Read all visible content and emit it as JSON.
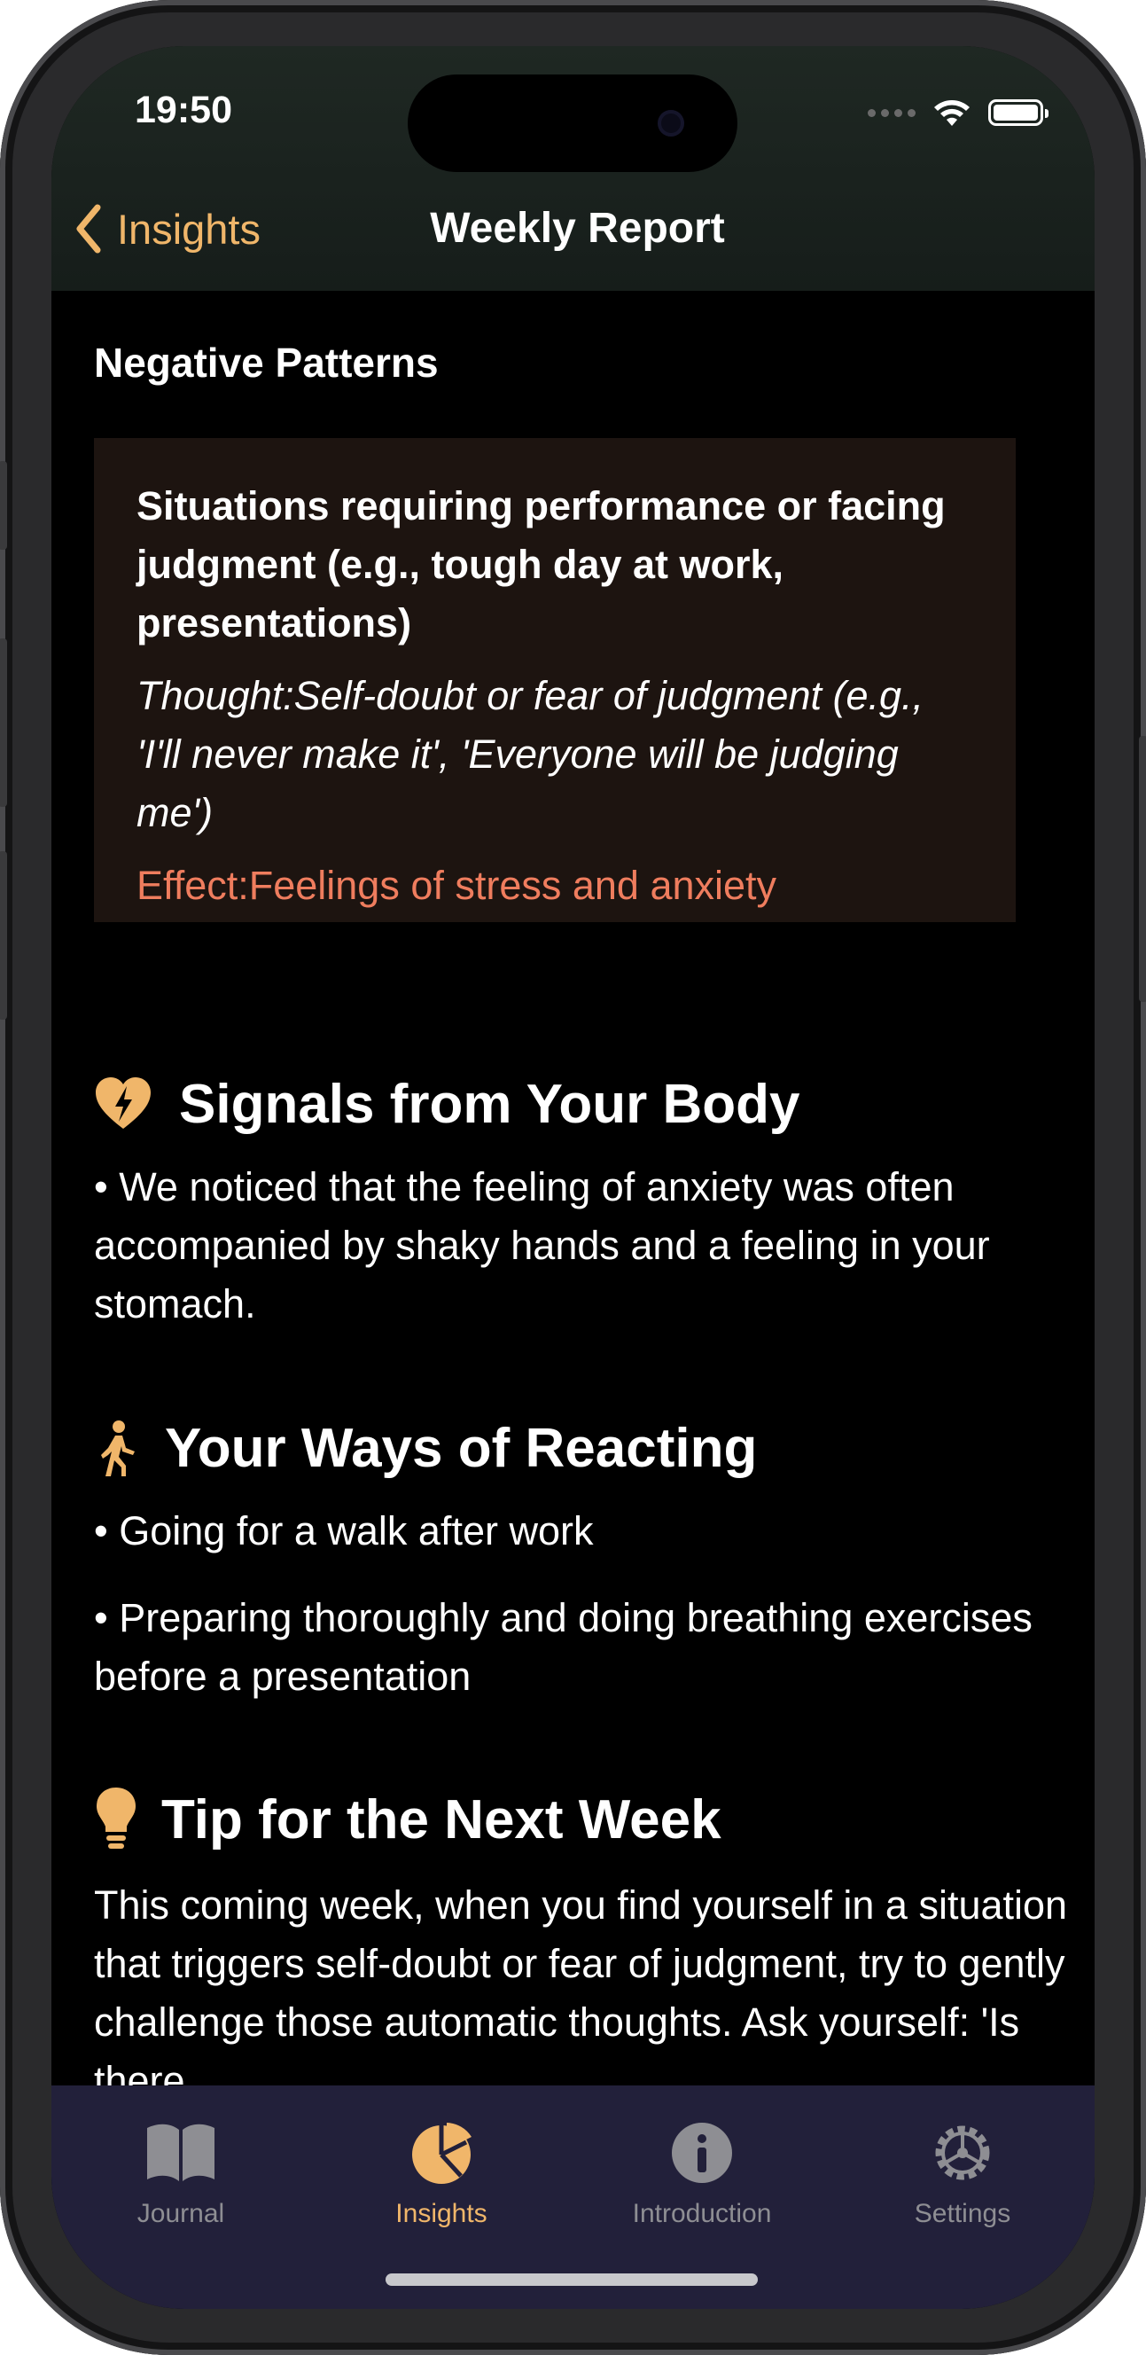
{
  "status_bar": {
    "time": "19:50"
  },
  "nav": {
    "back_label": "Insights",
    "title": "Weekly Report"
  },
  "negative_patterns": {
    "heading": "Negative Patterns",
    "situation": "Situations requiring performance or facing judgment (e.g., tough day at work, presentations)",
    "thought": "Thought:Self-doubt or fear of judgment (e.g., 'I'll never make it', 'Everyone will be judging me')",
    "effect": "Effect:Feelings of stress and anxiety"
  },
  "body_signals": {
    "heading": "Signals from Your Body",
    "icon": "broken-heart-bolt-icon",
    "text": "• We noticed that the feeling of anxiety was often accompanied by shaky hands and a feeling in your stomach."
  },
  "reactions": {
    "heading": "Your Ways of Reacting",
    "icon": "walking-figure-icon",
    "items": [
      "• Going for a walk after work",
      "• Preparing thoroughly and doing breathing exercises before a presentation"
    ]
  },
  "tip": {
    "heading": "Tip for the Next Week",
    "icon": "lightbulb-icon",
    "text": "This coming week, when you find yourself in a situation that triggers self-doubt or fear of judgment, try to gently challenge those automatic thoughts. Ask yourself: 'Is there"
  },
  "tabbar": {
    "tabs": [
      {
        "label": "Journal",
        "icon": "book-icon",
        "active": false
      },
      {
        "label": "Insights",
        "icon": "pie-chart-icon",
        "active": true
      },
      {
        "label": "Introduction",
        "icon": "info-icon",
        "active": false
      },
      {
        "label": "Settings",
        "icon": "gear-icon",
        "active": false
      }
    ]
  },
  "colors": {
    "accent": "#f0b66a",
    "effect_text": "#ef7d5e",
    "card_bg": "#1d1410",
    "tabbar_bg": "#22203a",
    "tab_inactive": "#8e8e93"
  }
}
